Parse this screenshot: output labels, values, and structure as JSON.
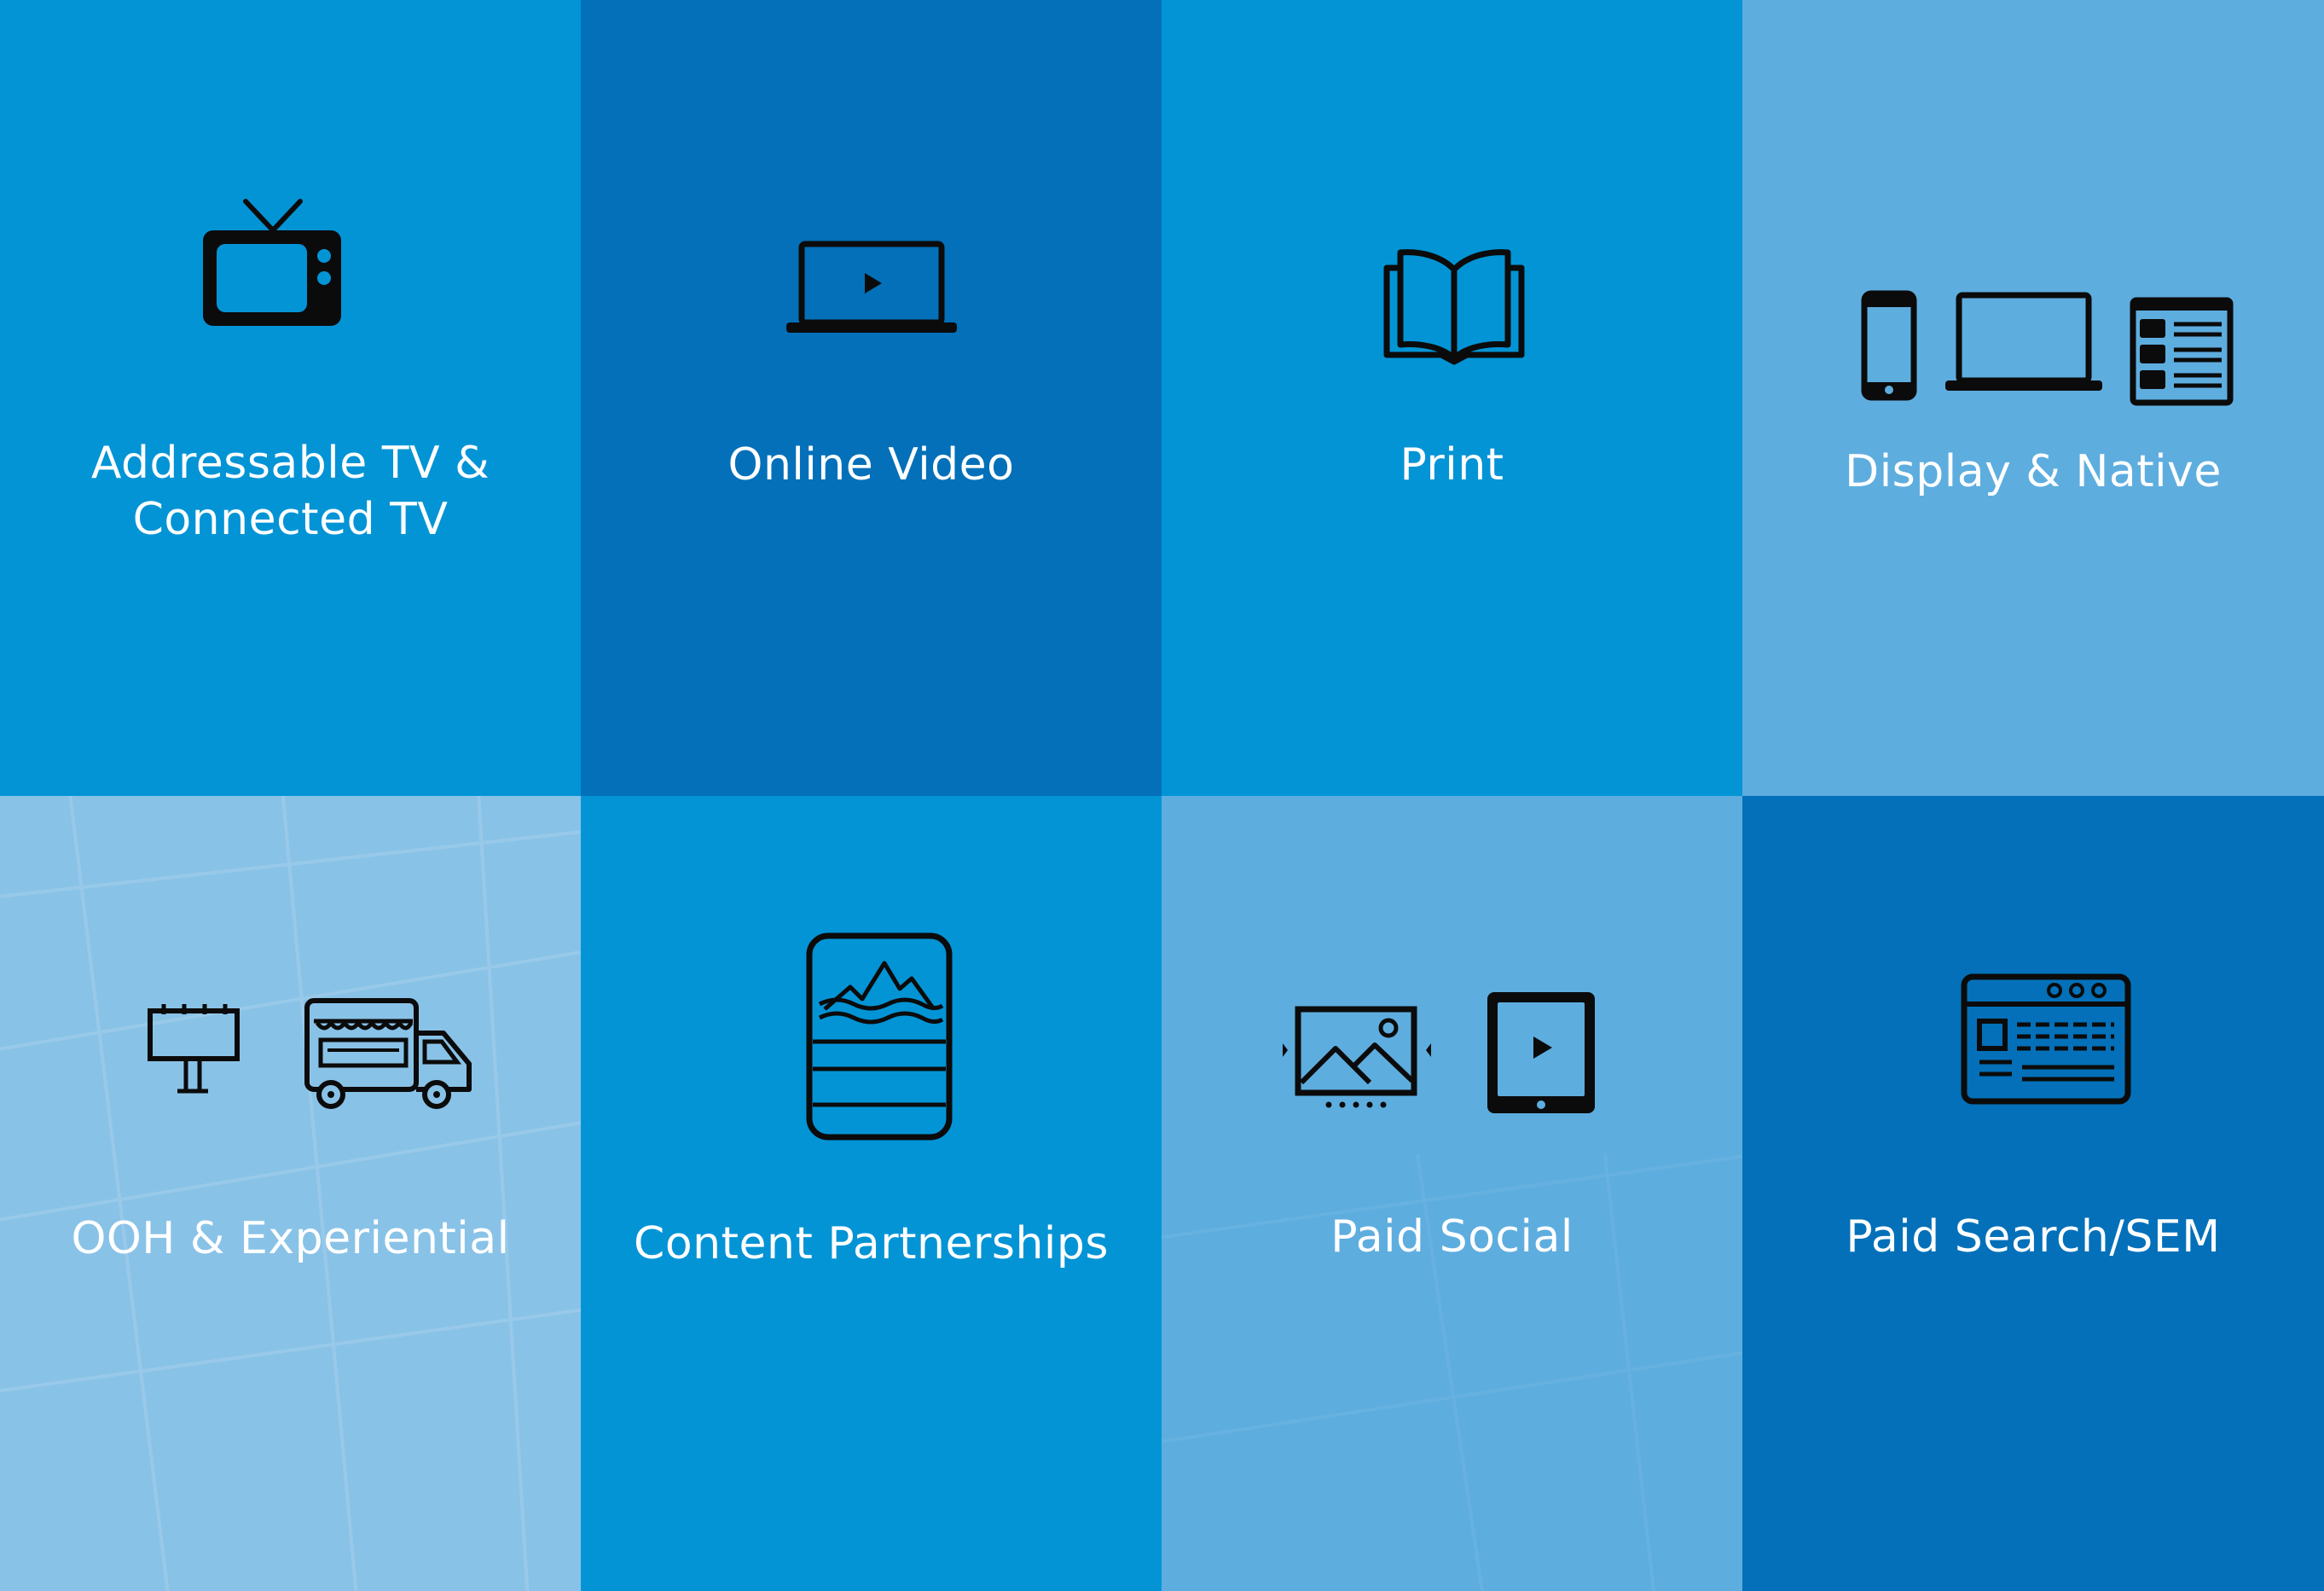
{
  "colors": {
    "medium_blue": "#0394d6",
    "dark_blue": "#0370b9",
    "light_blue": "#5eaddf",
    "pale_blue": "#89c2e7",
    "icon": "#0b0b0b",
    "text": "#ffffff"
  },
  "tiles": [
    {
      "label": "Addressable TV &\nConnected TV",
      "icon": "tv-icon"
    },
    {
      "label": "Online Video",
      "icon": "laptop-video-icon"
    },
    {
      "label": "Print",
      "icon": "open-book-icon"
    },
    {
      "label": "Display & Native",
      "icon": "devices-icon"
    },
    {
      "label": "OOH & Experiential",
      "icon": "billboard-truck-icon"
    },
    {
      "label": "Content Partnerships",
      "icon": "article-tablet-icon"
    },
    {
      "label": "Paid Social",
      "icon": "image-video-icon"
    },
    {
      "label": "Paid Search/SEM",
      "icon": "browser-icon"
    }
  ]
}
